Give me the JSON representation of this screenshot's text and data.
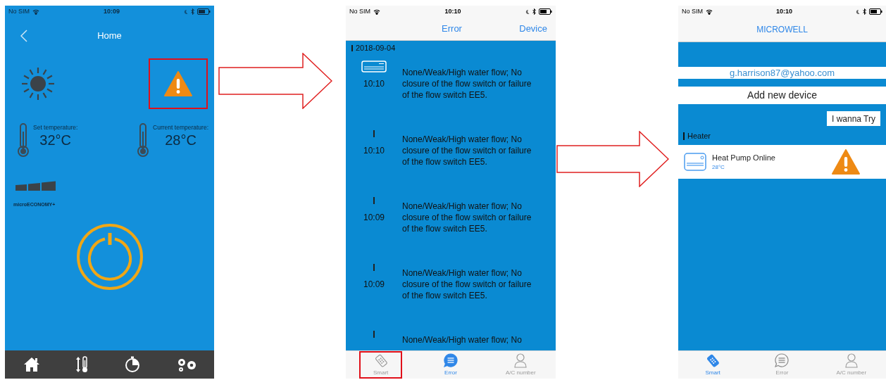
{
  "home_screen": {
    "status_bar": {
      "carrier": "No SIM",
      "time": "10:09"
    },
    "title": "Home",
    "warning": {
      "highlighted": true
    },
    "set_temperature": {
      "label": "Set temperature:",
      "value": "32°C"
    },
    "current_temperature": {
      "label": "Current temperature:",
      "value": "28°C"
    },
    "mode_label": "microECONOMY+"
  },
  "error_screen": {
    "status_bar": {
      "carrier": "No SIM",
      "time": "10:10"
    },
    "title": "Error",
    "right_action": "Device",
    "date": "2018-09-04",
    "entries": [
      {
        "kind": "device",
        "time": "10:10",
        "message": "None/Weak/High water flow; No closure of the flow switch or failure of the flow switch EE5."
      },
      {
        "kind": "marker",
        "time": "10:10",
        "message": "None/Weak/High water flow; No closure of the flow switch or failure of the flow switch EE5."
      },
      {
        "kind": "marker",
        "time": "10:09",
        "message": "None/Weak/High water flow; No closure of the flow switch or failure of the flow switch EE5."
      },
      {
        "kind": "marker",
        "time": "10:09",
        "message": "None/Weak/High water flow; No closure of the flow switch or failure of the flow switch EE5."
      },
      {
        "kind": "marker",
        "message": "None/Weak/High water flow; No"
      }
    ],
    "tabs": [
      {
        "label": "Smart",
        "selected": false,
        "highlighted": true
      },
      {
        "label": "Error",
        "selected": true,
        "highlighted": false
      },
      {
        "label": "A/C number",
        "selected": false,
        "highlighted": false
      }
    ]
  },
  "device_screen": {
    "status_bar": {
      "carrier": "No SIM",
      "time": "10:10"
    },
    "title": "MICROWELL",
    "account_email": "g.harrison87@yahoo.com",
    "add_button": "Add new device",
    "try_button": "I wanna Try",
    "section": "Heater",
    "devices": [
      {
        "name": "Heat Pump Online",
        "temperature": "28°C",
        "warning": true
      }
    ],
    "tabs": [
      {
        "label": "Smart",
        "selected": true
      },
      {
        "label": "Error",
        "selected": false
      },
      {
        "label": "A/C number",
        "selected": false
      }
    ]
  }
}
